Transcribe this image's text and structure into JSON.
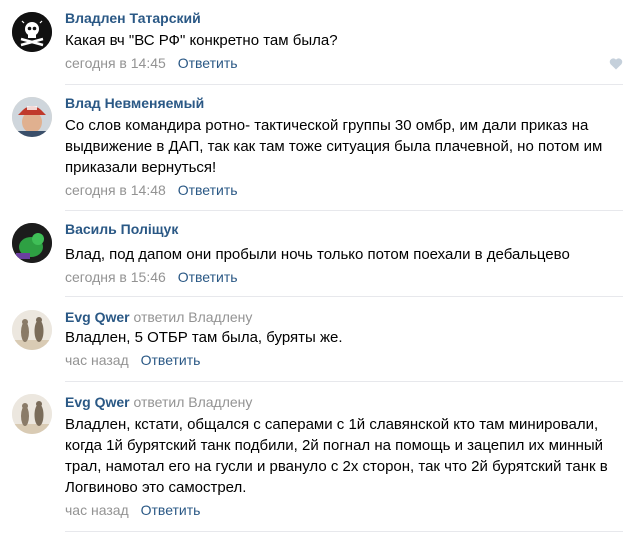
{
  "comments": [
    {
      "author": "Владлен Татарский",
      "replied_to": "",
      "text": "Какая вч \"ВС РФ\" конкретно там была?",
      "time": "сегодня в 14:45",
      "reply_label": "Ответить",
      "avatar_icon": "pirate-skull-icon"
    },
    {
      "author": "Влад Невменяемый",
      "replied_to": "",
      "text": "Со слов командира ротно- тактической группы 30 омбр, им дали приказ на выдвижение в ДАП, так как там тоже ситуация была плачевной, но потом им приказали вернуться!",
      "time": "сегодня в 14:48",
      "reply_label": "Ответить",
      "avatar_icon": "man-red-cap-photo"
    },
    {
      "author": "Василь Поліщук",
      "replied_to": "",
      "text": "Влад, под дапом они пробыли ночь только потом поехали в дебальцево",
      "time": "сегодня в 15:46",
      "reply_label": "Ответить",
      "avatar_icon": "green-figure-photo"
    },
    {
      "author": "Evg Qwer",
      "replied_to": "ответил Владлену",
      "text": "Владлен, 5 ОТБР там была, буряты же.",
      "time": "час назад",
      "reply_label": "Ответить",
      "avatar_icon": "sand-sculptures-photo"
    },
    {
      "author": "Evg Qwer",
      "replied_to": "ответил Владлену",
      "text": "Владлен, кстати, общался с саперами с 1й славянской кто там минировали, когда 1й бурятский танк подбили, 2й погнал на помощь и зацепил их минный трал, намотал его на гусли и рвануло с 2х сторон, так что 2й бурятский танк в Логвиново это самострел.",
      "time": "час назад",
      "reply_label": "Ответить",
      "avatar_icon": "sand-sculptures-photo"
    }
  ],
  "colors": {
    "link": "#2a5885",
    "muted": "#939393",
    "divider": "#e7e8ec",
    "heart": "#c5d0db"
  }
}
